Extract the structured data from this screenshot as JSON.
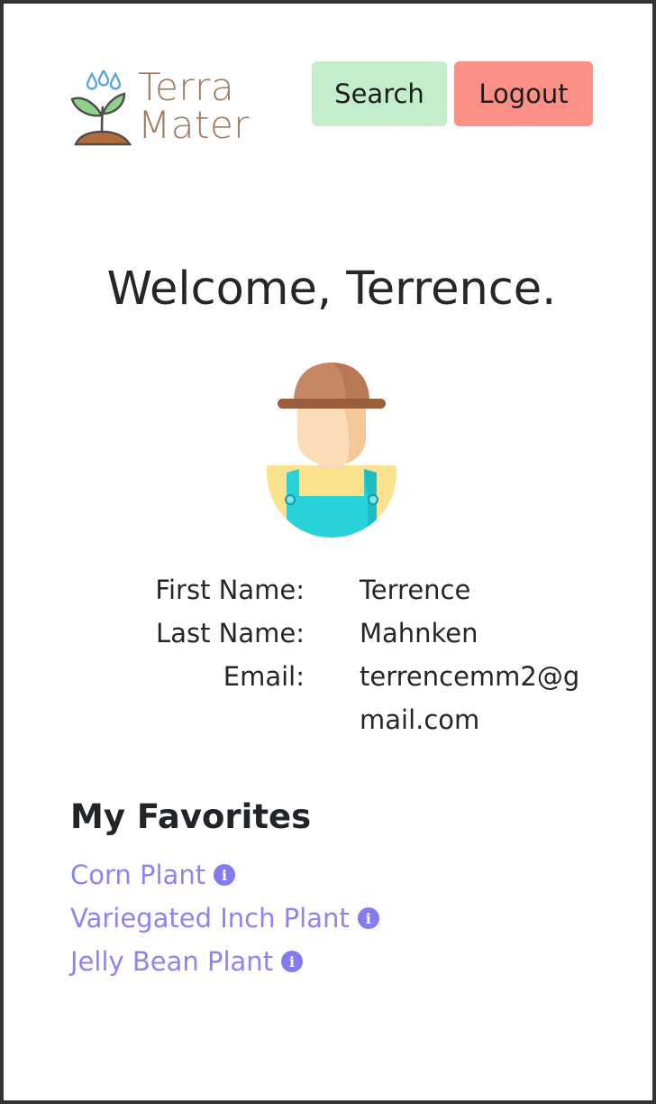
{
  "header": {
    "logo": {
      "line1": "Terra",
      "line2": "Mater"
    },
    "search_label": "Search",
    "logout_label": "Logout"
  },
  "welcome": "Welcome, Terrence.",
  "profile": {
    "first_name_label": "First Name:",
    "first_name": "Terrence",
    "last_name_label": "Last Name:",
    "last_name": "Mahnken",
    "email_label": "Email:",
    "email": "terrencemm2@gmail.com"
  },
  "favorites": {
    "title": "My Favorites",
    "items": [
      {
        "label": "Corn Plant"
      },
      {
        "label": "Variegated Inch Plant"
      },
      {
        "label": "Jelly Bean Plant"
      }
    ]
  },
  "colors": {
    "search_button": "#c4edcc",
    "logout_button": "#fc8f86",
    "link": "#8b84f4",
    "logo_text": "#a07a5e"
  },
  "icons": {
    "logo": "sprout-icon",
    "avatar": "farmer-avatar-icon",
    "favorite_info": "info-circle-icon"
  }
}
